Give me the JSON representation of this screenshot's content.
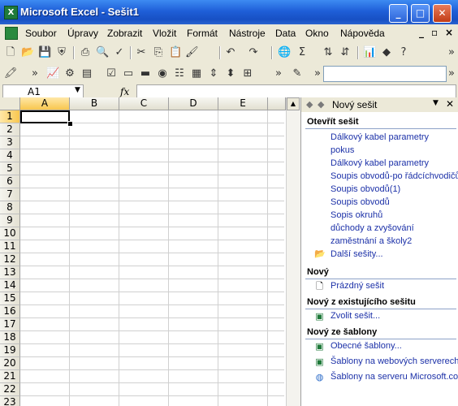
{
  "window": {
    "title": "Microsoft Excel - Sešit1"
  },
  "menu": [
    "Soubor",
    "Úpravy",
    "Zobrazit",
    "Vložit",
    "Formát",
    "Nástroje",
    "Data",
    "Okno",
    "Nápověda"
  ],
  "formula_bar": {
    "name_box": "A1",
    "fx": "fx"
  },
  "columns": [
    "A",
    "B",
    "C",
    "D",
    "E"
  ],
  "rows": [
    "1",
    "2",
    "3",
    "4",
    "5",
    "6",
    "7",
    "8",
    "9",
    "10",
    "11",
    "12",
    "13",
    "14",
    "15",
    "16",
    "17",
    "18",
    "19",
    "20",
    "21",
    "22",
    "23"
  ],
  "task_pane": {
    "title": "Nový sešit",
    "open_section": "Otevřít sešit",
    "recent_files": [
      "Dálkový kabel parametry",
      "pokus",
      "Dálkový kabel parametry",
      "Soupis obvodů-po řádcíchvodičů",
      "Soupis obvodů(1)",
      "Soupis obvodů",
      "Sopis okruhů",
      "důchody a zvyšování",
      "zaměstnání a školy2"
    ],
    "more_workbooks": "Další sešity...",
    "new_section": "Nový",
    "blank_workbook": "Prázdný sešit",
    "from_existing_section": "Nový z existujícího sešitu",
    "choose_workbook": "Zvolit sešit...",
    "from_template_section": "Nový ze šablony",
    "general_templates": "Obecné šablony...",
    "web_templates": "Šablony na webových serverech...",
    "ms_templates": "Šablony na serveru Microsoft.com"
  }
}
